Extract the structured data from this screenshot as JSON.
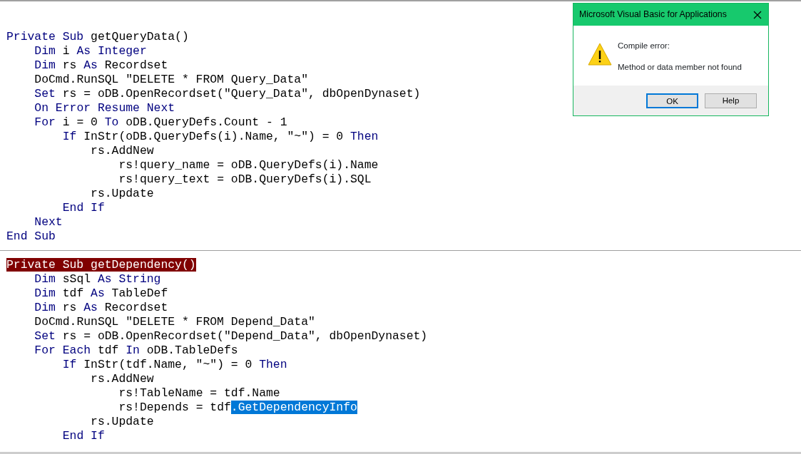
{
  "editor": {
    "procedures": [
      {
        "header_highlighted": false,
        "lines": [
          {
            "code": [
              {
                "kind": "keyword",
                "text": "Private Sub"
              },
              {
                "kind": "plain",
                "text": " getQueryData()"
              }
            ],
            "children": [
              {
                "code": [
                  {
                    "kind": "keyword",
                    "text": "Dim"
                  },
                  {
                    "kind": "plain",
                    "text": " i "
                  },
                  {
                    "kind": "keyword",
                    "text": "As Integer"
                  }
                ]
              },
              {
                "code": [
                  {
                    "kind": "keyword",
                    "text": "Dim"
                  },
                  {
                    "kind": "plain",
                    "text": " rs "
                  },
                  {
                    "kind": "keyword",
                    "text": "As"
                  },
                  {
                    "kind": "plain",
                    "text": " Recordset"
                  }
                ]
              },
              {
                "code": [
                  {
                    "kind": "plain",
                    "text": "DoCmd.RunSQL \"DELETE * FROM Query_Data\""
                  }
                ]
              },
              {
                "code": [
                  {
                    "kind": "keyword",
                    "text": "Set"
                  },
                  {
                    "kind": "plain",
                    "text": " rs = oDB.OpenRecordset(\"Query_Data\", dbOpenDynaset)"
                  }
                ]
              },
              {
                "code": [
                  {
                    "kind": "keyword",
                    "text": "On Error Resume Next"
                  }
                ]
              },
              {
                "code": [
                  {
                    "kind": "keyword",
                    "text": "For"
                  },
                  {
                    "kind": "plain",
                    "text": " i = 0 "
                  },
                  {
                    "kind": "keyword",
                    "text": "To"
                  },
                  {
                    "kind": "plain",
                    "text": " oDB.QueryDefs.Count - 1"
                  }
                ],
                "children": [
                  {
                    "code": [
                      {
                        "kind": "keyword",
                        "text": "If"
                      },
                      {
                        "kind": "plain",
                        "text": " InStr(oDB.QueryDefs(i).Name, \"~\") = 0 "
                      },
                      {
                        "kind": "keyword",
                        "text": "Then"
                      }
                    ],
                    "children": [
                      {
                        "code": [
                          {
                            "kind": "plain",
                            "text": "rs.AddNew"
                          }
                        ],
                        "children": [
                          {
                            "code": [
                              {
                                "kind": "plain",
                                "text": "rs!query_name = oDB.QueryDefs(i).Name"
                              }
                            ]
                          },
                          {
                            "code": [
                              {
                                "kind": "plain",
                                "text": "rs!query_text = oDB.QueryDefs(i).SQL"
                              }
                            ]
                          }
                        ]
                      },
                      {
                        "code": [
                          {
                            "kind": "plain",
                            "text": "rs.Update"
                          }
                        ]
                      }
                    ]
                  },
                  {
                    "code": [
                      {
                        "kind": "keyword",
                        "text": "End If"
                      }
                    ]
                  }
                ]
              },
              {
                "code": [
                  {
                    "kind": "keyword",
                    "text": "Next"
                  }
                ]
              }
            ]
          },
          {
            "code": [
              {
                "kind": "keyword",
                "text": "End Sub"
              }
            ]
          }
        ]
      },
      {
        "header_highlighted": true,
        "lines": [
          {
            "code": [
              {
                "kind": "keyword",
                "text": "Private Sub"
              },
              {
                "kind": "plain",
                "text": " getDependency()"
              }
            ],
            "children": [
              {
                "code": [
                  {
                    "kind": "keyword",
                    "text": "Dim"
                  },
                  {
                    "kind": "plain",
                    "text": " sSql "
                  },
                  {
                    "kind": "keyword",
                    "text": "As String"
                  }
                ]
              },
              {
                "code": [
                  {
                    "kind": "keyword",
                    "text": "Dim"
                  },
                  {
                    "kind": "plain",
                    "text": " tdf "
                  },
                  {
                    "kind": "keyword",
                    "text": "As"
                  },
                  {
                    "kind": "plain",
                    "text": " TableDef"
                  }
                ]
              },
              {
                "code": [
                  {
                    "kind": "keyword",
                    "text": "Dim"
                  },
                  {
                    "kind": "plain",
                    "text": " rs "
                  },
                  {
                    "kind": "keyword",
                    "text": "As"
                  },
                  {
                    "kind": "plain",
                    "text": " Recordset"
                  }
                ]
              },
              {
                "code": [
                  {
                    "kind": "plain",
                    "text": "DoCmd.RunSQL \"DELETE * FROM Depend_Data\""
                  }
                ]
              },
              {
                "code": [
                  {
                    "kind": "keyword",
                    "text": "Set"
                  },
                  {
                    "kind": "plain",
                    "text": " rs = oDB.OpenRecordset(\"Depend_Data\", dbOpenDynaset)"
                  }
                ]
              },
              {
                "code": [
                  {
                    "kind": "keyword",
                    "text": "For Each"
                  },
                  {
                    "kind": "plain",
                    "text": " tdf "
                  },
                  {
                    "kind": "keyword",
                    "text": "In"
                  },
                  {
                    "kind": "plain",
                    "text": " oDB.TableDefs"
                  }
                ],
                "children": [
                  {
                    "code": [
                      {
                        "kind": "keyword",
                        "text": "If"
                      },
                      {
                        "kind": "plain",
                        "text": " InStr(tdf.Name, \"~\") = 0 "
                      },
                      {
                        "kind": "keyword",
                        "text": "Then"
                      }
                    ],
                    "children": [
                      {
                        "code": [
                          {
                            "kind": "plain",
                            "text": "rs.AddNew"
                          }
                        ],
                        "children": [
                          {
                            "code": [
                              {
                                "kind": "plain",
                                "text": "rs!TableName = tdf.Name"
                              }
                            ]
                          },
                          {
                            "code": [
                              {
                                "kind": "plain",
                                "text": "rs!Depends = tdf"
                              },
                              {
                                "kind": "selection",
                                "text": ".GetDependencyInfo"
                              }
                            ]
                          }
                        ]
                      },
                      {
                        "code": [
                          {
                            "kind": "plain",
                            "text": "rs.Update"
                          }
                        ]
                      }
                    ]
                  },
                  {
                    "code": [
                      {
                        "kind": "keyword",
                        "text": "End If"
                      }
                    ]
                  }
                ]
              }
            ]
          }
        ]
      }
    ]
  },
  "dialog": {
    "title": "Microsoft Visual Basic for Applications",
    "heading": "Compile error:",
    "message": "Method or data member not found",
    "buttons": [
      {
        "label": "OK",
        "default": true
      },
      {
        "label": "Help",
        "default": false
      }
    ]
  }
}
